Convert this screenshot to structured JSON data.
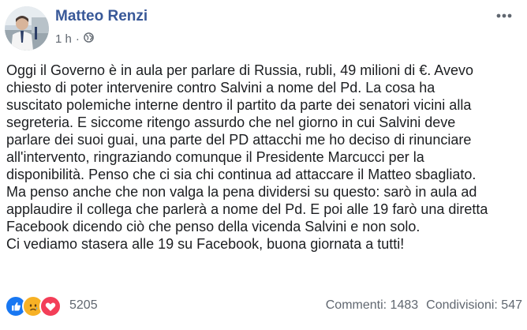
{
  "author": {
    "name": "Matteo Renzi"
  },
  "meta": {
    "time": "1 h",
    "separator": "·",
    "audience_icon": "globe-icon"
  },
  "more_icon": "ellipsis-icon",
  "body_lines": [
    "Oggi il Governo è in aula per parlare di Russia, rubli, 49 milioni di €. Avevo",
    "chiesto di poter intervenire contro Salvini a nome del Pd. La cosa ha",
    "suscitato polemiche interne dentro il partito da parte dei senatori vicini alla",
    "segreteria. E siccome ritengo assurdo che nel giorno in cui Salvini deve",
    "parlare dei suoi guai, una parte del PD attacchi me ho deciso di rinunciare",
    "all'intervento, ringraziando comunque il Presidente Marcucci per la",
    "disponibilità. Penso che ci sia chi continua ad attaccare il Matteo sbagliato.",
    "Ma penso anche che non valga la pena dividersi su questo: sarò in aula ad",
    "applaudire il collega che parlerà a nome del Pd. E poi alle 19 farò una diretta",
    "Facebook dicendo ciò che penso della vicenda Salvini e non solo.",
    "Ci vediamo stasera alle 19 su Facebook, buona giornata a tutti!"
  ],
  "reactions": {
    "icons": [
      "like-icon",
      "sad-icon",
      "love-icon"
    ],
    "count": "5205"
  },
  "stats": {
    "comments": "Commenti: 1483",
    "shares": "Condivisioni: 547"
  },
  "colors": {
    "author": "#385898",
    "like": "#1877f2",
    "sad": "#f7b125",
    "love": "#f33e58",
    "muted": "#606770"
  }
}
